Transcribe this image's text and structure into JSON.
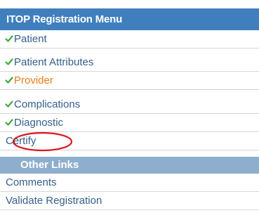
{
  "menu": {
    "title": "ITOP Registration Menu",
    "items": [
      {
        "label": "Patient",
        "checked": true,
        "active": false
      },
      {
        "label": "Patient Attributes",
        "checked": true,
        "active": false
      },
      {
        "label": "Provider",
        "checked": true,
        "active": true
      },
      {
        "label": "Complications",
        "checked": true,
        "active": false
      },
      {
        "label": "Diagnostic",
        "checked": true,
        "active": false
      },
      {
        "label": "Certify",
        "checked": false,
        "active": false
      }
    ],
    "other_links": {
      "title": "Other Links",
      "items": [
        {
          "label": "Comments"
        },
        {
          "label": "Validate Registration"
        }
      ]
    }
  },
  "colors": {
    "header_bg": "#3f7fbd",
    "section_bg": "#8eaecd",
    "link_text": "#345f8c",
    "active_text": "#e87c17",
    "check": "#3faa3a",
    "annotation": "#e0141e"
  },
  "icons": {
    "check": "checkmark-icon"
  }
}
